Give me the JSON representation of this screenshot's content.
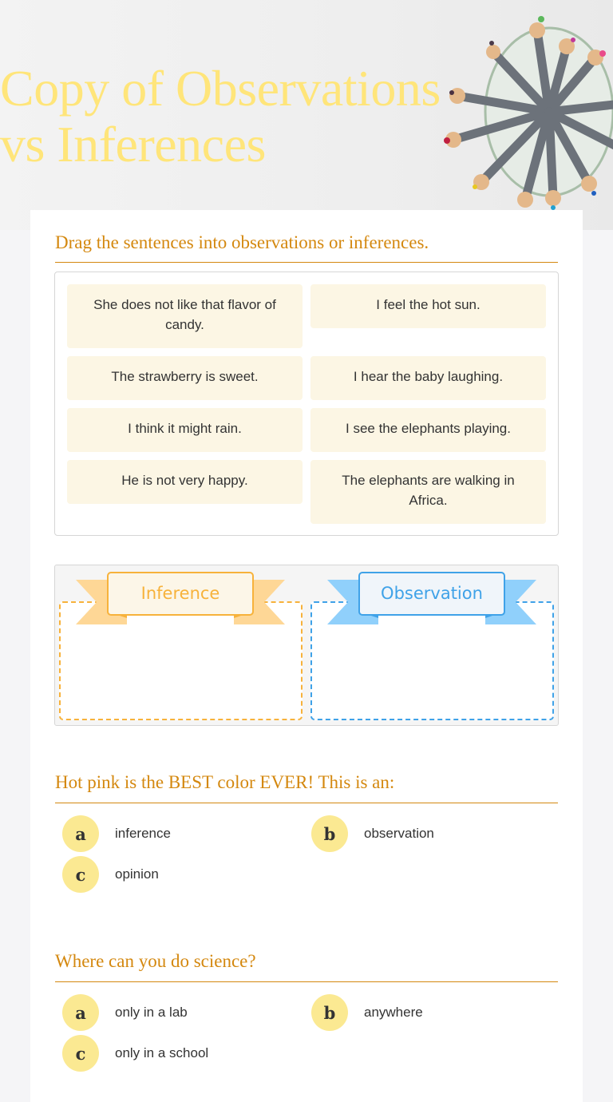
{
  "header": {
    "title": "Copy of Observations vs Inferences",
    "image": "colored-pencils-in-cup"
  },
  "colors": {
    "title": "#ffe57a",
    "question": "#d4880f",
    "chip_bg": "#fcf6e4",
    "inference": "#f7b23b",
    "observation": "#3fa2e8",
    "bubble": "#fbe992"
  },
  "drag_activity": {
    "prompt": "Drag the sentences into observations or inferences.",
    "items": [
      "She does not like that flavor of candy.",
      "I feel the hot sun.",
      "The strawberry is sweet.",
      "I hear the baby laughing.",
      "I think it might rain.",
      "I see the elephants playing.",
      "He is not very happy.",
      "The elephants are walking in Africa."
    ],
    "bins": [
      {
        "label": "Inference"
      },
      {
        "label": "Observation"
      }
    ]
  },
  "questions": [
    {
      "prompt": "Hot pink is the BEST color EVER! This is an:",
      "options": [
        {
          "letter": "a",
          "text": "inference"
        },
        {
          "letter": "b",
          "text": "observation"
        },
        {
          "letter": "c",
          "text": "opinion"
        }
      ]
    },
    {
      "prompt": "Where can you do science?",
      "options": [
        {
          "letter": "a",
          "text": "only in a lab"
        },
        {
          "letter": "b",
          "text": "anywhere"
        },
        {
          "letter": "c",
          "text": "only in a school"
        }
      ]
    }
  ]
}
